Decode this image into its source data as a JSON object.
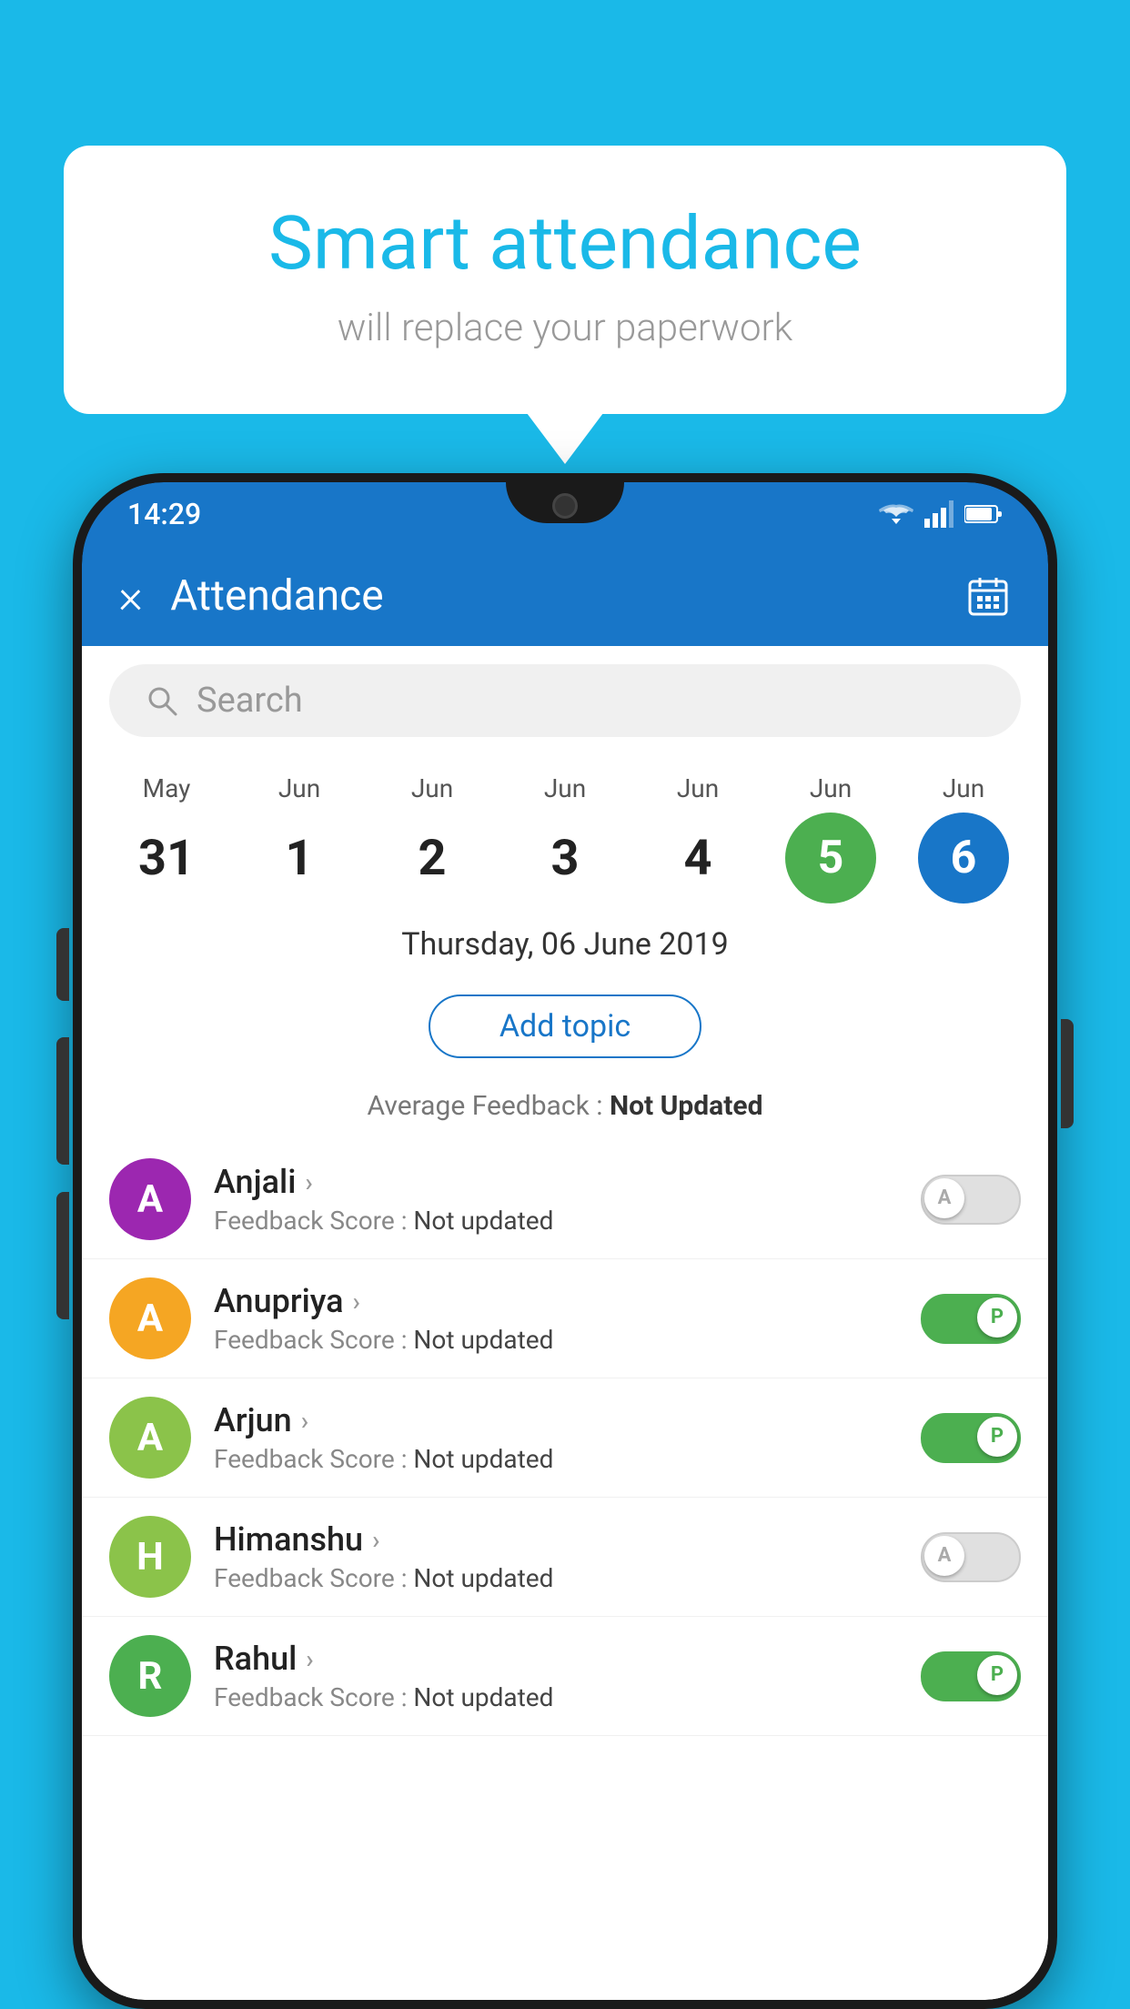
{
  "background_color": "#1ab9e8",
  "bubble": {
    "title": "Smart attendance",
    "subtitle": "will replace your paperwork"
  },
  "status_bar": {
    "time": "14:29",
    "icons": [
      "wifi",
      "signal",
      "battery"
    ]
  },
  "app_bar": {
    "title": "Attendance",
    "close_label": "×",
    "calendar_icon": "calendar"
  },
  "search": {
    "placeholder": "Search"
  },
  "calendar": {
    "days": [
      {
        "month": "May",
        "day": "31",
        "state": "normal"
      },
      {
        "month": "Jun",
        "day": "1",
        "state": "normal"
      },
      {
        "month": "Jun",
        "day": "2",
        "state": "normal"
      },
      {
        "month": "Jun",
        "day": "3",
        "state": "normal"
      },
      {
        "month": "Jun",
        "day": "4",
        "state": "normal"
      },
      {
        "month": "Jun",
        "day": "5",
        "state": "today"
      },
      {
        "month": "Jun",
        "day": "6",
        "state": "selected"
      }
    ]
  },
  "selected_date": "Thursday, 06 June 2019",
  "add_topic_label": "Add topic",
  "average_feedback": {
    "label": "Average Feedback : ",
    "value": "Not Updated"
  },
  "students": [
    {
      "name": "Anjali",
      "avatar_letter": "A",
      "avatar_color": "#9c27b0",
      "feedback_label": "Feedback Score : ",
      "feedback_value": "Not updated",
      "toggle_state": "off",
      "toggle_letter": "A"
    },
    {
      "name": "Anupriya",
      "avatar_letter": "A",
      "avatar_color": "#f5a623",
      "feedback_label": "Feedback Score : ",
      "feedback_value": "Not updated",
      "toggle_state": "on",
      "toggle_letter": "P"
    },
    {
      "name": "Arjun",
      "avatar_letter": "A",
      "avatar_color": "#8bc34a",
      "feedback_label": "Feedback Score : ",
      "feedback_value": "Not updated",
      "toggle_state": "on",
      "toggle_letter": "P"
    },
    {
      "name": "Himanshu",
      "avatar_letter": "H",
      "avatar_color": "#8bc34a",
      "feedback_label": "Feedback Score : ",
      "feedback_value": "Not updated",
      "toggle_state": "off",
      "toggle_letter": "A"
    },
    {
      "name": "Rahul",
      "avatar_letter": "R",
      "avatar_color": "#4caf50",
      "feedback_label": "Feedback Score : ",
      "feedback_value": "Not updated",
      "toggle_state": "on",
      "toggle_letter": "P"
    }
  ]
}
